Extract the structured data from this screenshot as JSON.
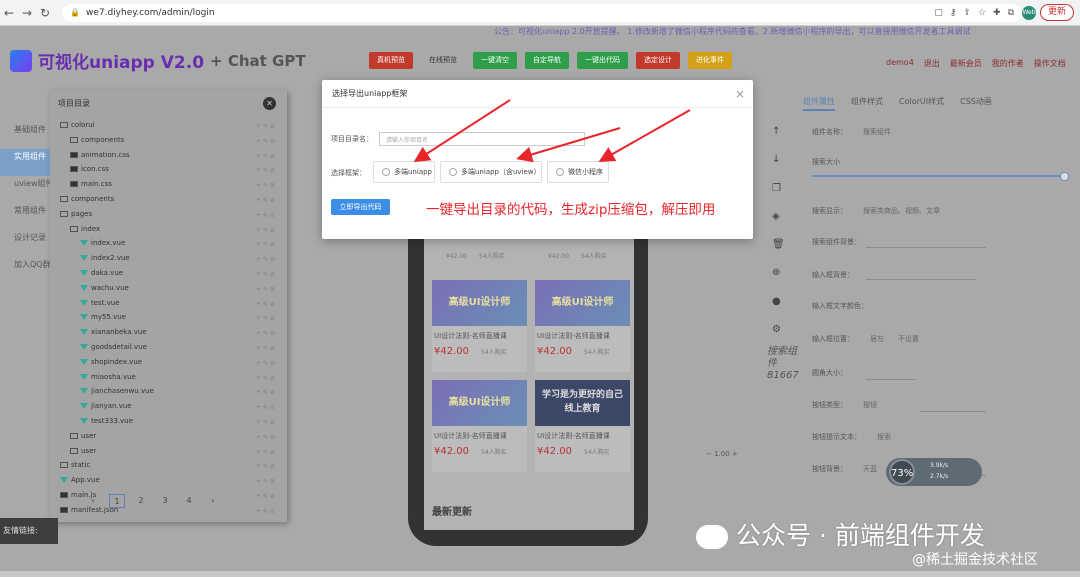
{
  "browser": {
    "url": "we7.diyhey.com/admin/login",
    "update_label": "更新",
    "avatar_text": "Web"
  },
  "page": {
    "announcement": "公告：可视化uniapp 2.0开放提醒。 1.修改新增了微信小程序代码的查看。2.新增微信小程序的导出，可以直接用微信开发者工具调试",
    "logo_main": "可视化uniapp V2.0",
    "logo_plus": "+ Chat GPT",
    "toolbar": [
      {
        "label": "真机预览",
        "color": "#c0392b"
      },
      {
        "label": "在线预览",
        "color": "transparent"
      },
      {
        "label": "一键清空",
        "color": "#2e9e4a"
      },
      {
        "label": "自定导航",
        "color": "#2e9e4a"
      },
      {
        "label": "一键出代码",
        "color": "#2e9e4a"
      },
      {
        "label": "选定设计",
        "color": "#c0392b"
      },
      {
        "label": "进化事件",
        "color": "#d4a017"
      }
    ],
    "top_links": [
      "demo4",
      "退出",
      "最新会员",
      "我的作者",
      "操作文档"
    ],
    "left_menu": [
      "基础组件",
      "实用组件",
      "uview组件",
      "常用组件",
      "设计记录",
      "加入QQ群"
    ],
    "footer_left": "友情链接:"
  },
  "tree": {
    "title": "项目目录",
    "rows": [
      {
        "name": "colorui",
        "kind": "folder",
        "indent": 0
      },
      {
        "name": "components",
        "kind": "folder",
        "indent": 1
      },
      {
        "name": "animation.css",
        "kind": "file",
        "indent": 1
      },
      {
        "name": "icon.css",
        "kind": "file",
        "indent": 1
      },
      {
        "name": "main.css",
        "kind": "file",
        "indent": 1
      },
      {
        "name": "components",
        "kind": "folder",
        "indent": 0
      },
      {
        "name": "pages",
        "kind": "folder",
        "indent": 0
      },
      {
        "name": "index",
        "kind": "folder",
        "indent": 1
      },
      {
        "name": "index.vue",
        "kind": "vue",
        "indent": 2
      },
      {
        "name": "index2.vue",
        "kind": "vue",
        "indent": 2
      },
      {
        "name": "daka.vue",
        "kind": "vue",
        "indent": 2
      },
      {
        "name": "wachu.vue",
        "kind": "vue",
        "indent": 2
      },
      {
        "name": "test.vue",
        "kind": "vue",
        "indent": 2
      },
      {
        "name": "my55.vue",
        "kind": "vue",
        "indent": 2
      },
      {
        "name": "xiananbeka.vue",
        "kind": "vue",
        "indent": 2
      },
      {
        "name": "goodsdetail.vue",
        "kind": "vue",
        "indent": 2
      },
      {
        "name": "shopindex.vue",
        "kind": "vue",
        "indent": 2
      },
      {
        "name": "miaosha.vue",
        "kind": "vue",
        "indent": 2
      },
      {
        "name": "jianchasenwu.vue",
        "kind": "vue",
        "indent": 2
      },
      {
        "name": "jianyan.vue",
        "kind": "vue",
        "indent": 2
      },
      {
        "name": "test333.vue",
        "kind": "vue",
        "indent": 2
      },
      {
        "name": "user",
        "kind": "folder",
        "indent": 1
      },
      {
        "name": "user",
        "kind": "folder",
        "indent": 1
      },
      {
        "name": "static",
        "kind": "folder",
        "indent": 0
      },
      {
        "name": "App.vue",
        "kind": "vue",
        "indent": 0
      },
      {
        "name": "main.js",
        "kind": "file",
        "indent": 0
      },
      {
        "name": "manifest.json",
        "kind": "file",
        "indent": 0
      }
    ],
    "pages": [
      "1",
      "2",
      "3",
      "4"
    ]
  },
  "phone": {
    "price": "¥42.00",
    "buyers": "54人购买",
    "card_title": "高级UI设计师",
    "card_caption": "UI设计法则-名师直播课",
    "dark_title_1": "学习是为更好的自己",
    "dark_title_2": "线上教育",
    "latest": "最新更新"
  },
  "right": {
    "tabs": [
      "组件属性",
      "组件样式",
      "ColorUI样式",
      "CSS动画"
    ],
    "props": [
      {
        "label": "组件名称：",
        "value": "搜索组件"
      },
      {
        "label": "搜索大小",
        "value": ""
      },
      {
        "label": "搜索显示：",
        "value": "搜索类商品、视频、文章"
      },
      {
        "label": "搜索组件背景：",
        "value": ""
      },
      {
        "label": "输入框背景：",
        "value": ""
      },
      {
        "label": "输入框文字颜色：",
        "value": ""
      },
      {
        "label": "输入框位置：",
        "value": "居左　　不设置"
      },
      {
        "label": "圆角大小：",
        "value": ""
      },
      {
        "label": "按钮类型：",
        "value": "按钮"
      },
      {
        "label": "按钮提示文本：",
        "value": "搜索"
      },
      {
        "label": "按钮背景：",
        "value": "天蓝"
      }
    ],
    "vertical_text": "搜索组件81667",
    "zoom": "1.00",
    "gauge": {
      "value": "73%",
      "up": "3.9k/s",
      "down": "2.7k/s"
    }
  },
  "modal": {
    "title": "选择导出uniapp框架",
    "project_label": "项目目录名：",
    "project_placeholder": "请输入你项目名",
    "framework_label": "选择框架：",
    "options": [
      "多端uniapp",
      "多端uniapp（含uview）",
      "微信小程序"
    ],
    "export_button": "立即导出代码",
    "note": "一键导出目录的代码，生成zip压缩包，解压即用"
  },
  "watermark": {
    "main": "公众号 · 前端组件开发",
    "sub": "@稀土掘金技术社区"
  },
  "colors": {
    "accent": "#3a8ee6",
    "note_red": "#e8252a"
  }
}
